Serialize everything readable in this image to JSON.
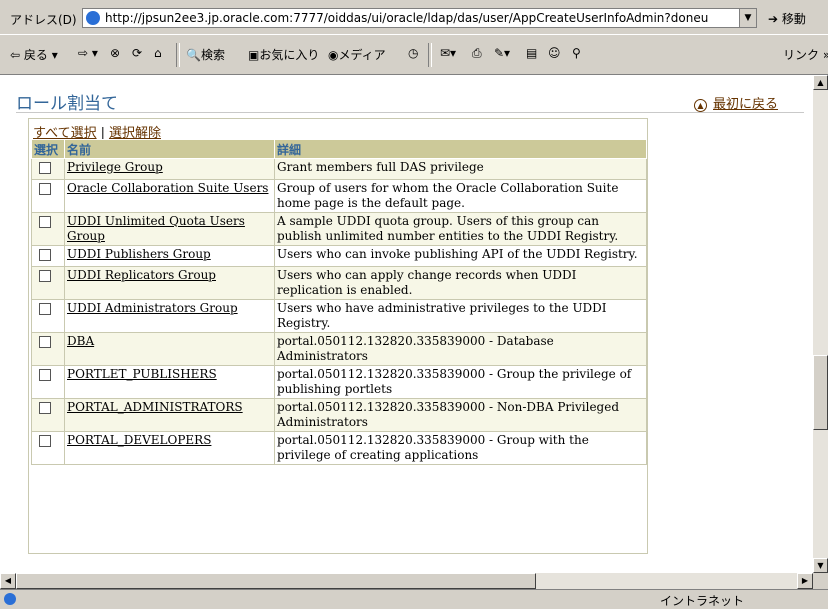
{
  "address_bar": {
    "label": "アドレス(D)",
    "url": "http://jpsun2ee3.jp.oracle.com:7777/oiddas/ui/oracle/ldap/das/user/AppCreateUserInfoAdmin?doneu",
    "go_label": "移動"
  },
  "toolbar": {
    "back": "戻る",
    "search": "検索",
    "favorites": "お気に入り",
    "media": "メディア",
    "links": "リンク"
  },
  "page": {
    "title": "ロール割当て",
    "back_to_top": "最初に戻る",
    "select_all": "すべて選択",
    "deselect_all": "選択解除",
    "separator": "|",
    "columns": {
      "select": "選択",
      "name": "名前",
      "detail": "詳細"
    },
    "rows": [
      {
        "name": "Privilege Group",
        "detail": "Grant members full DAS privilege"
      },
      {
        "name": "Oracle Collaboration Suite Users",
        "detail": "Group of users for whom the Oracle Collaboration Suite home page is the default page."
      },
      {
        "name": "UDDI Unlimited Quota Users Group",
        "detail": "A sample UDDI quota group. Users of this group can publish unlimited number entities to the UDDI Registry."
      },
      {
        "name": "UDDI Publishers Group",
        "detail": "Users who can invoke publishing API of the UDDI Registry."
      },
      {
        "name": "UDDI Replicators Group",
        "detail": "Users who can apply change records when UDDI replication is enabled."
      },
      {
        "name": "UDDI Administrators Group",
        "detail": "Users who have administrative privileges to the UDDI Registry."
      },
      {
        "name": "DBA",
        "detail": "portal.050112.132820.335839000 - Database Administrators"
      },
      {
        "name": "PORTLET_PUBLISHERS",
        "detail": "portal.050112.132820.335839000 - Group the privilege of publishing portlets"
      },
      {
        "name": "PORTAL_ADMINISTRATORS",
        "detail": "portal.050112.132820.335839000 - Non-DBA Privileged Administrators"
      },
      {
        "name": "PORTAL_DEVELOPERS",
        "detail": "portal.050112.132820.335839000 - Group with the privilege of creating applications"
      }
    ]
  },
  "status_bar": {
    "zone": "イントラネット"
  }
}
